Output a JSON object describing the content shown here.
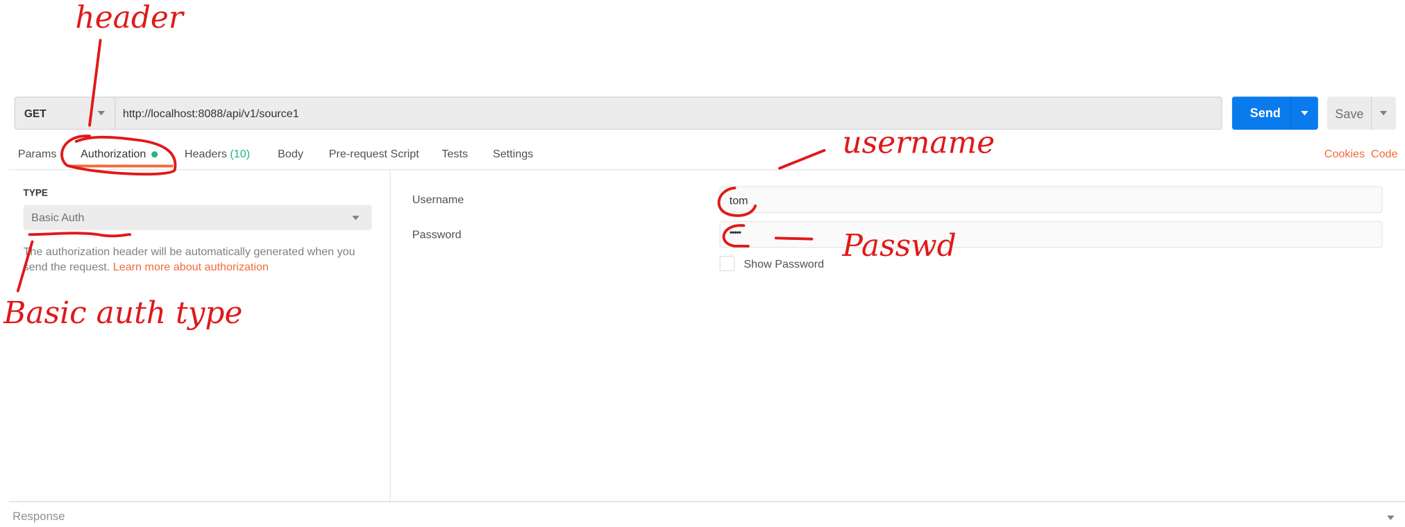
{
  "request": {
    "method": "GET",
    "url": "http://localhost:8088/api/v1/source1",
    "send_label": "Send",
    "save_label": "Save"
  },
  "tabs": [
    {
      "label": "Params"
    },
    {
      "label": "Authorization",
      "active": true,
      "indicator": "green-dot"
    },
    {
      "label": "Headers",
      "count": "(10)"
    },
    {
      "label": "Body"
    },
    {
      "label": "Pre-request Script"
    },
    {
      "label": "Tests"
    },
    {
      "label": "Settings"
    }
  ],
  "links": {
    "cookies": "Cookies",
    "code": "Code"
  },
  "auth": {
    "type_label": "TYPE",
    "type_value": "Basic Auth",
    "description": "The authorization header will be automatically generated when you send the request.",
    "learn_more": "Learn more about authorization",
    "username_label": "Username",
    "username_value": "tom",
    "password_label": "Password",
    "password_value": "•••••",
    "show_password_label": "Show Password",
    "show_password_checked": false
  },
  "response": {
    "label": "Response"
  },
  "annotations": {
    "header": "header",
    "username": "username",
    "passwd": "Passwd",
    "basic_auth_type": "Basic auth type"
  },
  "colors": {
    "accent": "#f26b3a",
    "send": "#097bed",
    "success": "#26b47f",
    "annotation": "#e01919"
  }
}
